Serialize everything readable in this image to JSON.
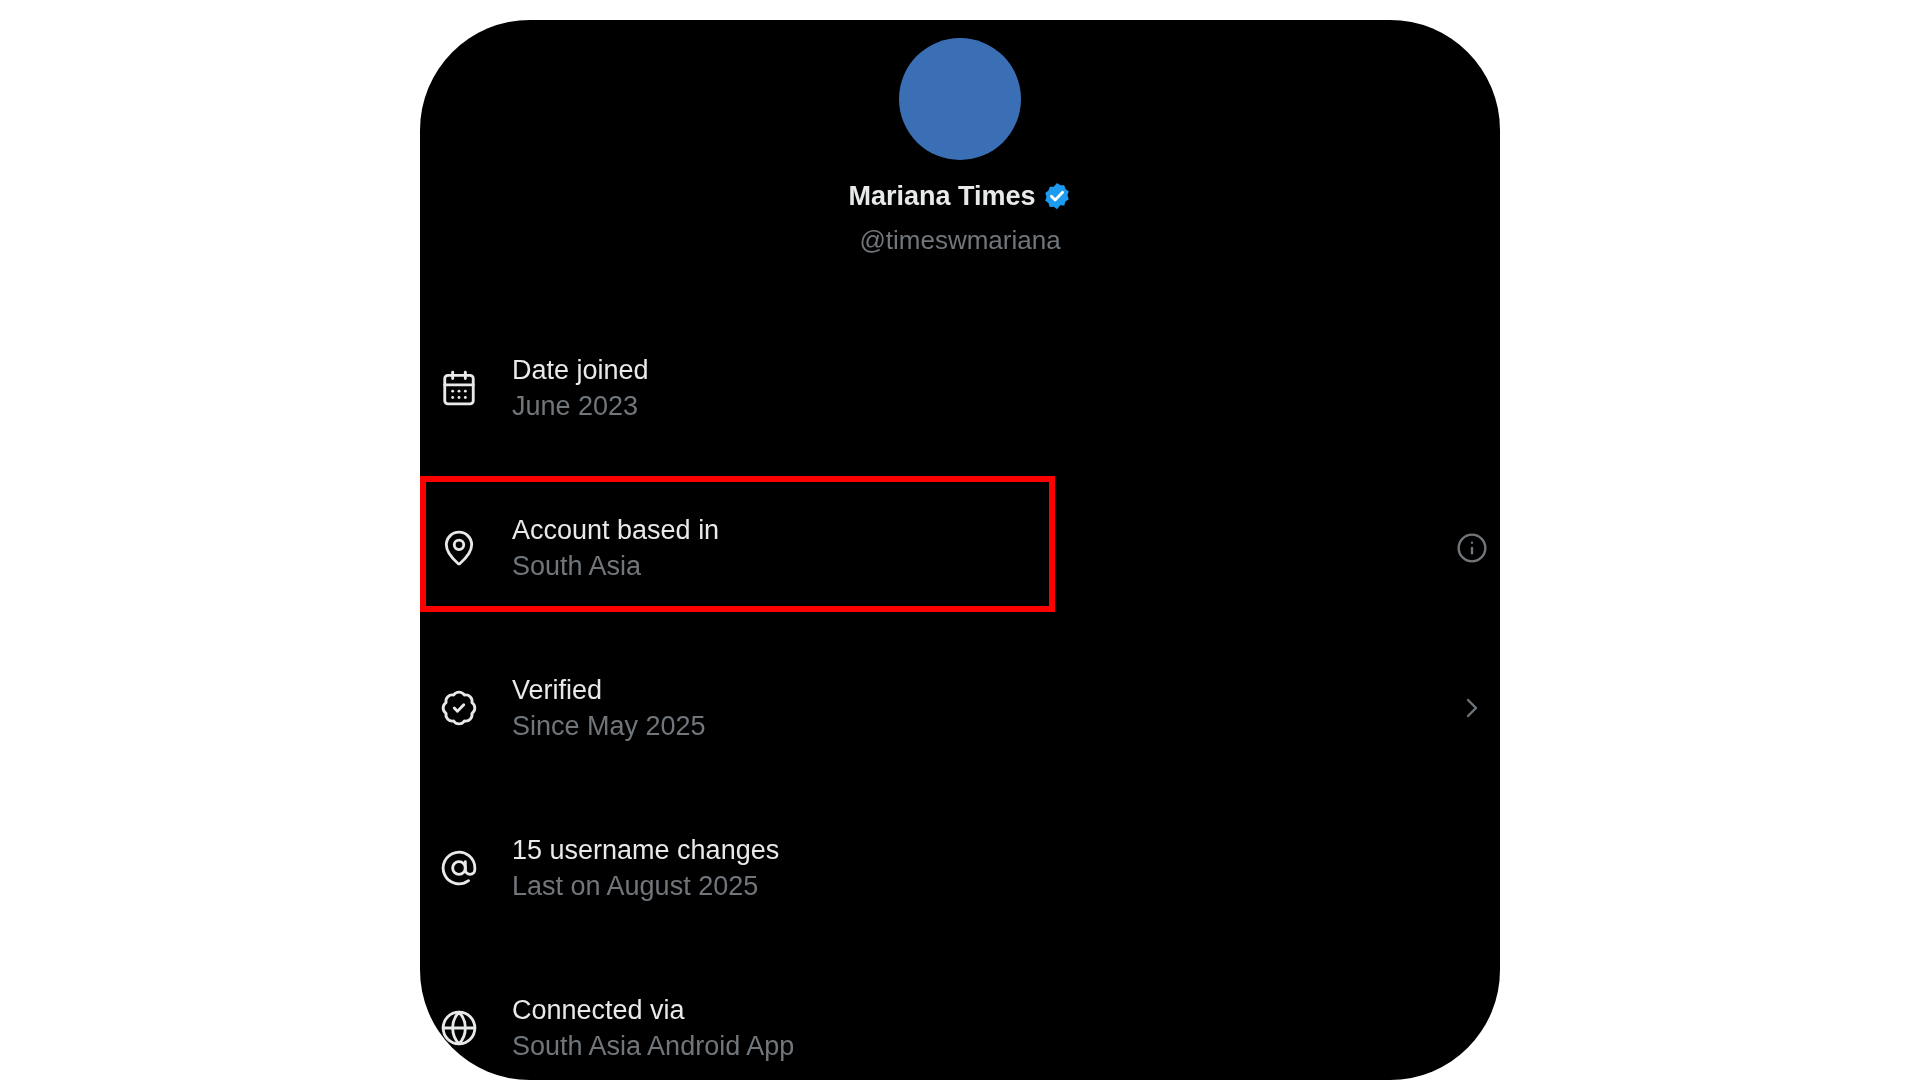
{
  "profile": {
    "name": "Mariana Times",
    "verified": true,
    "handle": "@timeswmariana"
  },
  "rows": [
    {
      "title": "Date joined",
      "subtitle": "June 2023",
      "highlighted": false,
      "kind": "plain"
    },
    {
      "title": "Account based in",
      "subtitle": "South Asia",
      "highlighted": true,
      "kind": "info"
    },
    {
      "title": "Verified",
      "subtitle": "Since May 2025",
      "highlighted": false,
      "kind": "link"
    },
    {
      "title": "15 username changes",
      "subtitle": "Last on August 2025",
      "highlighted": false,
      "kind": "plain"
    },
    {
      "title": "Connected via",
      "subtitle": "South Asia Android App",
      "highlighted": false,
      "kind": "plain"
    }
  ]
}
